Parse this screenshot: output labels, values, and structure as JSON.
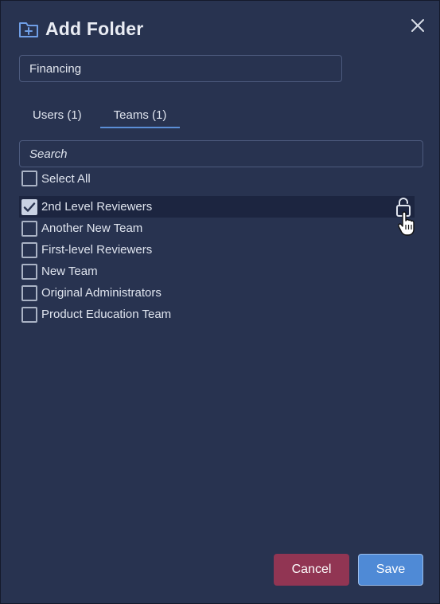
{
  "dialog": {
    "title": "Add Folder",
    "folder_icon": "folder-plus-icon",
    "close_icon": "close-icon"
  },
  "folder_name": {
    "value": "Financing"
  },
  "tabs": [
    {
      "label": "Users (1)",
      "active": false
    },
    {
      "label": "Teams (1)",
      "active": true
    }
  ],
  "search": {
    "placeholder": "Search"
  },
  "select_all": {
    "label": "Select All",
    "checked": false
  },
  "teams": [
    {
      "label": "2nd Level Reviewers",
      "checked": true,
      "highlighted": true,
      "trailing_icon": "unlock-icon"
    },
    {
      "label": "Another New Team",
      "checked": false
    },
    {
      "label": "First-level Reviewers",
      "checked": false
    },
    {
      "label": "New Team",
      "checked": false
    },
    {
      "label": "Original Administrators",
      "checked": false
    },
    {
      "label": "Product Education Team",
      "checked": false
    }
  ],
  "buttons": {
    "cancel": "Cancel",
    "save": "Save"
  },
  "colors": {
    "background": "#283350",
    "border": "#4c5a7d",
    "tab_underline": "#5b8ed6",
    "cancel": "#913553",
    "save": "#4f8ad6",
    "icon_accent": "#6f9ee6"
  }
}
